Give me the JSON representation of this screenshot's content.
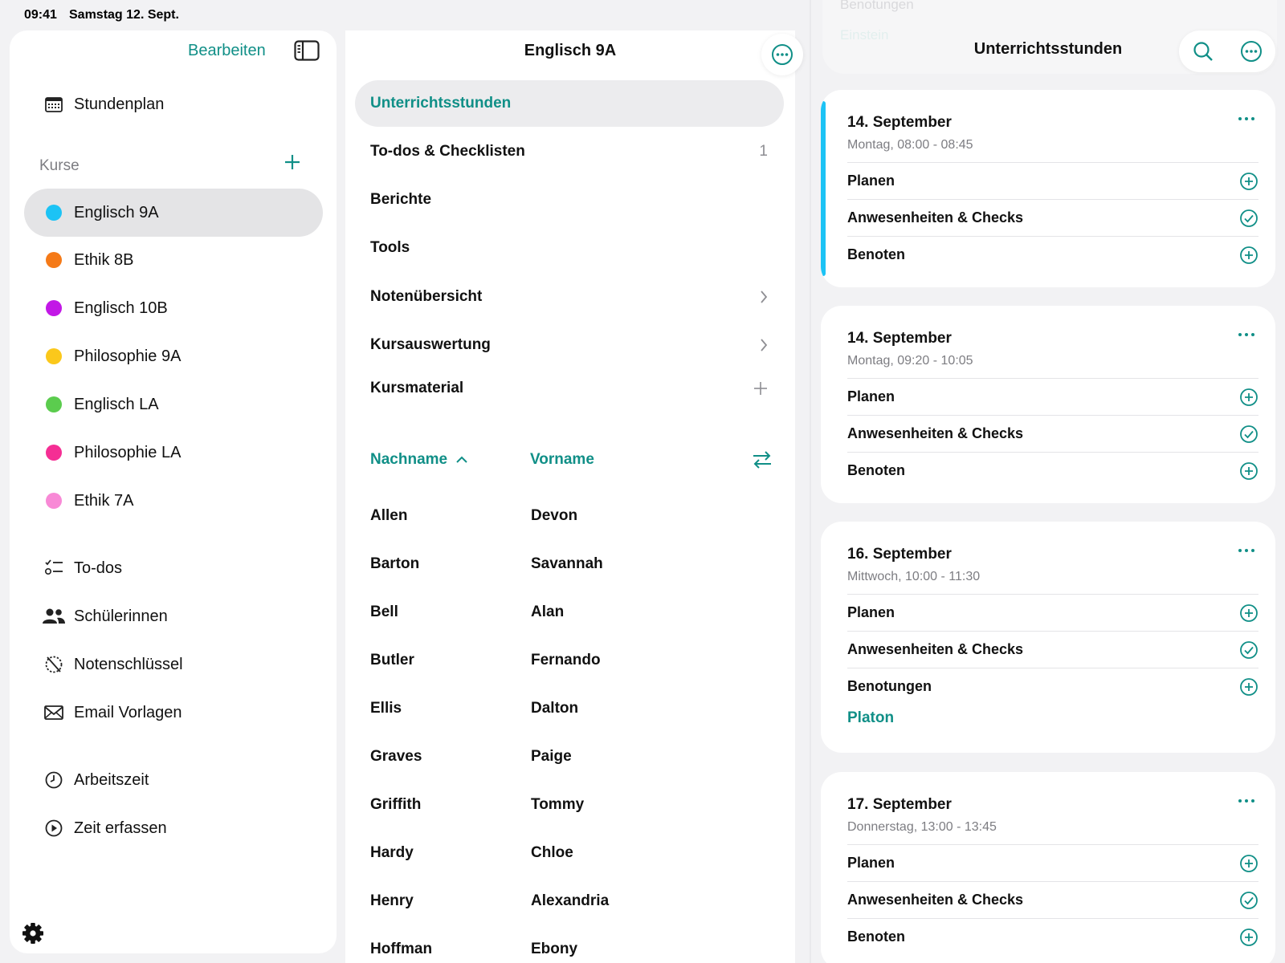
{
  "status": {
    "time": "09:41",
    "date": "Samstag 12. Sept."
  },
  "sidebar": {
    "edit_label": "Bearbeiten",
    "top_items": [
      {
        "label": "Stundenplan",
        "icon": "calendar-icon"
      }
    ],
    "courses_header": "Kurse",
    "courses": [
      {
        "label": "Englisch 9A",
        "color": "#1cc3f5",
        "active": true
      },
      {
        "label": "Ethik 8B",
        "color": "#f57a18"
      },
      {
        "label": "Englisch 10B",
        "color": "#c218e6"
      },
      {
        "label": "Philosophie 9A",
        "color": "#fbc81b"
      },
      {
        "label": "Englisch LA",
        "color": "#5bcc4e"
      },
      {
        "label": "Philosophie LA",
        "color": "#f52e94"
      },
      {
        "label": "Ethik 7A",
        "color": "#f889d6"
      }
    ],
    "tools": [
      {
        "label": "To-dos",
        "icon": "checklist-icon"
      },
      {
        "label": "Schülerinnen",
        "icon": "people-icon"
      },
      {
        "label": "Notenschlüssel",
        "icon": "grade-key-icon"
      },
      {
        "label": "Email Vorlagen",
        "icon": "envelope-icon"
      }
    ],
    "time": [
      {
        "label": "Arbeitszeit",
        "icon": "clock-icon"
      },
      {
        "label": "Zeit erfassen",
        "icon": "play-icon"
      }
    ]
  },
  "middle": {
    "title": "Englisch 9A",
    "menu": [
      {
        "label": "Unterrichtsstunden",
        "active": true
      },
      {
        "label": "To-dos & Checklisten",
        "trail": "1"
      },
      {
        "label": "Berichte"
      },
      {
        "label": "Tools"
      },
      {
        "label": "Notenübersicht",
        "trail_icon": "chevron-right-icon"
      },
      {
        "label": "Kursauswertung",
        "trail_icon": "chevron-right-icon"
      },
      {
        "label": "Kursmaterial",
        "trail_icon": "plus-icon"
      }
    ],
    "col_lastname": "Nachname",
    "col_firstname": "Vorname",
    "students": [
      {
        "last": "Allen",
        "first": "Devon"
      },
      {
        "last": "Barton",
        "first": "Savannah"
      },
      {
        "last": "Bell",
        "first": "Alan"
      },
      {
        "last": "Butler",
        "first": "Fernando"
      },
      {
        "last": "Ellis",
        "first": "Dalton"
      },
      {
        "last": "Graves",
        "first": "Paige"
      },
      {
        "last": "Griffith",
        "first": "Tommy"
      },
      {
        "last": "Hardy",
        "first": "Chloe"
      },
      {
        "last": "Henry",
        "first": "Alexandria"
      },
      {
        "last": "Hoffman",
        "first": "Ebony"
      }
    ]
  },
  "right": {
    "title": "Unterrichtsstunden",
    "ghost_1": "Benotungen",
    "ghost_2": "Einstein",
    "lessons": [
      {
        "date": "14. September",
        "time": "Montag, 08:00 - 08:45",
        "accent": true,
        "items": [
          {
            "label": "Planen",
            "icon": "plus-circle-icon"
          },
          {
            "label": "Anwesenheiten & Checks",
            "icon": "check-circle-icon"
          },
          {
            "label": "Benoten",
            "icon": "plus-circle-icon"
          }
        ]
      },
      {
        "date": "14. September",
        "time": "Montag, 09:20 - 10:05",
        "items": [
          {
            "label": "Planen",
            "icon": "plus-circle-icon"
          },
          {
            "label": "Anwesenheiten & Checks",
            "icon": "check-circle-icon"
          },
          {
            "label": "Benoten",
            "icon": "plus-circle-icon"
          }
        ]
      },
      {
        "date": "16. September",
        "time": "Mittwoch, 10:00 - 11:30",
        "items": [
          {
            "label": "Planen",
            "icon": "plus-circle-icon"
          },
          {
            "label": "Anwesenheiten & Checks",
            "icon": "check-circle-icon"
          },
          {
            "label": "Benotungen",
            "icon": "plus-circle-icon"
          }
        ],
        "extra": "Platon"
      },
      {
        "date": "17. September",
        "time": "Donnerstag, 13:00 - 13:45",
        "items": [
          {
            "label": "Planen",
            "icon": "plus-circle-icon"
          },
          {
            "label": "Anwesenheiten & Checks",
            "icon": "check-circle-icon"
          },
          {
            "label": "Benoten",
            "icon": "plus-circle-icon"
          }
        ]
      }
    ]
  },
  "colors": {
    "accent": "#108f87",
    "active_lesson": "#1cc3f5"
  }
}
